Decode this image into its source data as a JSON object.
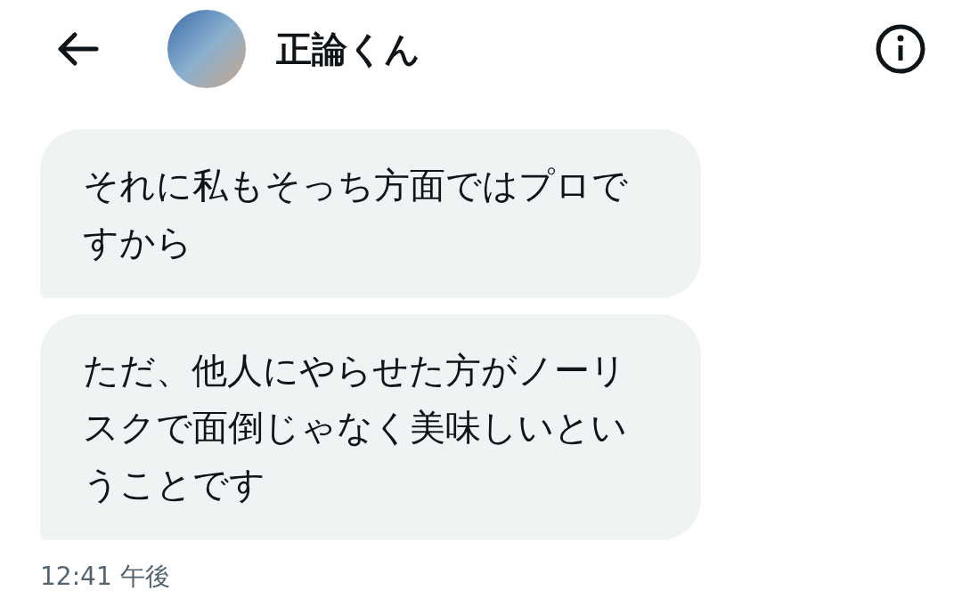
{
  "header": {
    "title": "正論くん"
  },
  "messages": [
    {
      "text": "それに私もそっち方面ではプロですから"
    },
    {
      "text": "ただ、他人にやらせた方がノーリスクで面倒じゃなく美味しいということです"
    }
  ],
  "timestamp": "12:41 午後"
}
